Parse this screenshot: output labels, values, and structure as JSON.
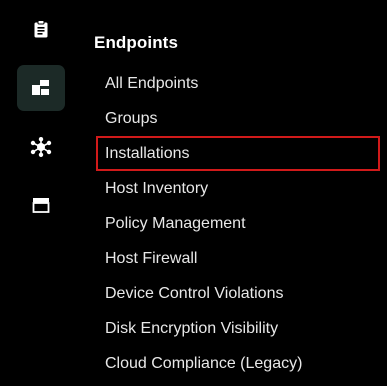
{
  "rail": {
    "items": [
      {
        "icon": "clipboard-icon",
        "active": false
      },
      {
        "icon": "endpoints-blocks-icon",
        "active": true
      },
      {
        "icon": "network-nodes-icon",
        "active": false
      },
      {
        "icon": "store-icon",
        "active": false
      }
    ]
  },
  "menu": {
    "title": "Endpoints",
    "items": [
      {
        "label": "All Endpoints"
      },
      {
        "label": "Groups"
      },
      {
        "label": "Installations",
        "highlighted": true
      },
      {
        "label": "Host Inventory"
      },
      {
        "label": "Policy Management"
      },
      {
        "label": "Host Firewall"
      },
      {
        "label": "Device Control Violations"
      },
      {
        "label": "Disk Encryption Visibility"
      },
      {
        "label": "Cloud Compliance (Legacy)"
      }
    ]
  },
  "colors": {
    "background": "#000000",
    "active_rail_bg": "#1c2a27",
    "highlight_border": "#d11a1a",
    "text": "#e8e8e8"
  }
}
